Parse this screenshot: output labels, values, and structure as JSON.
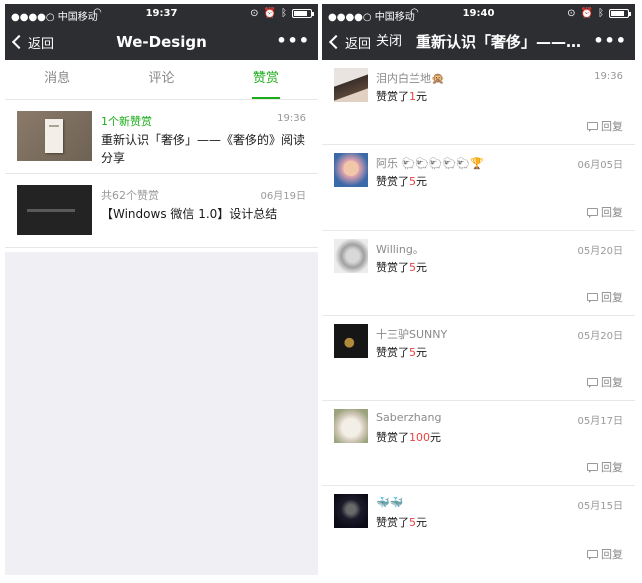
{
  "left_screen": {
    "status": {
      "carrier": "●●●●○ 中国移动",
      "time": "19:37",
      "battery_level": 0.8
    },
    "nav": {
      "back_label": "返回",
      "title": "We-Design",
      "more": "•••"
    },
    "tabs": [
      {
        "label": "消息"
      },
      {
        "label": "评论"
      },
      {
        "label": "赞赏"
      }
    ],
    "messages": [
      {
        "meta": "1个新赞赏",
        "time": "19:36",
        "text": "重新认识「奢侈」——《奢侈的》阅读分享",
        "thumb_icon": "book-photo"
      },
      {
        "meta": "共62个赞赏",
        "time": "06月19日",
        "text": "【Windows 微信 1.0】设计总结",
        "thumb_icon": "dark-screenshot"
      }
    ]
  },
  "right_screen": {
    "status": {
      "carrier": "●●●●○ 中国移动",
      "time": "19:40",
      "battery_level": 0.8
    },
    "nav": {
      "back_label": "返回",
      "close_label": "关闭",
      "title": "重新认识「奢侈」——…",
      "more": "•••"
    },
    "reply_label": "回复",
    "rewards": [
      {
        "name": "泪内白兰地🙊",
        "amount_prefix": "赞赏了",
        "amount": "1",
        "unit": "元",
        "date": "19:36"
      },
      {
        "name": "阿乐 🐑🐑🐑🐑🐑🏆",
        "amount_prefix": "赞赏了",
        "amount": "5",
        "unit": "元",
        "date": "06月05日"
      },
      {
        "name": "Willing。",
        "amount_prefix": "赞赏了",
        "amount": "5",
        "unit": "元",
        "date": "05月20日"
      },
      {
        "name": "十三驴SUNNY",
        "amount_prefix": "赞赏了",
        "amount": "5",
        "unit": "元",
        "date": "05月20日"
      },
      {
        "name": "Saberzhang",
        "amount_prefix": "赞赏了",
        "amount": "100",
        "unit": "元",
        "date": "05月17日"
      },
      {
        "name": "🐳🐳",
        "amount_prefix": "赞赏了",
        "amount": "5",
        "unit": "元",
        "date": "05月15日"
      }
    ]
  },
  "colors": {
    "accent_green": "#1aad19",
    "amount_red": "#e64340",
    "navbar": "#2d2e32"
  },
  "icons": {
    "wifi": "wifi-icon",
    "alarm": "alarm-icon",
    "bluetooth": "bluetooth-icon",
    "back": "chevron-left-icon",
    "more": "more-dots-icon",
    "reply": "comment-icon"
  }
}
